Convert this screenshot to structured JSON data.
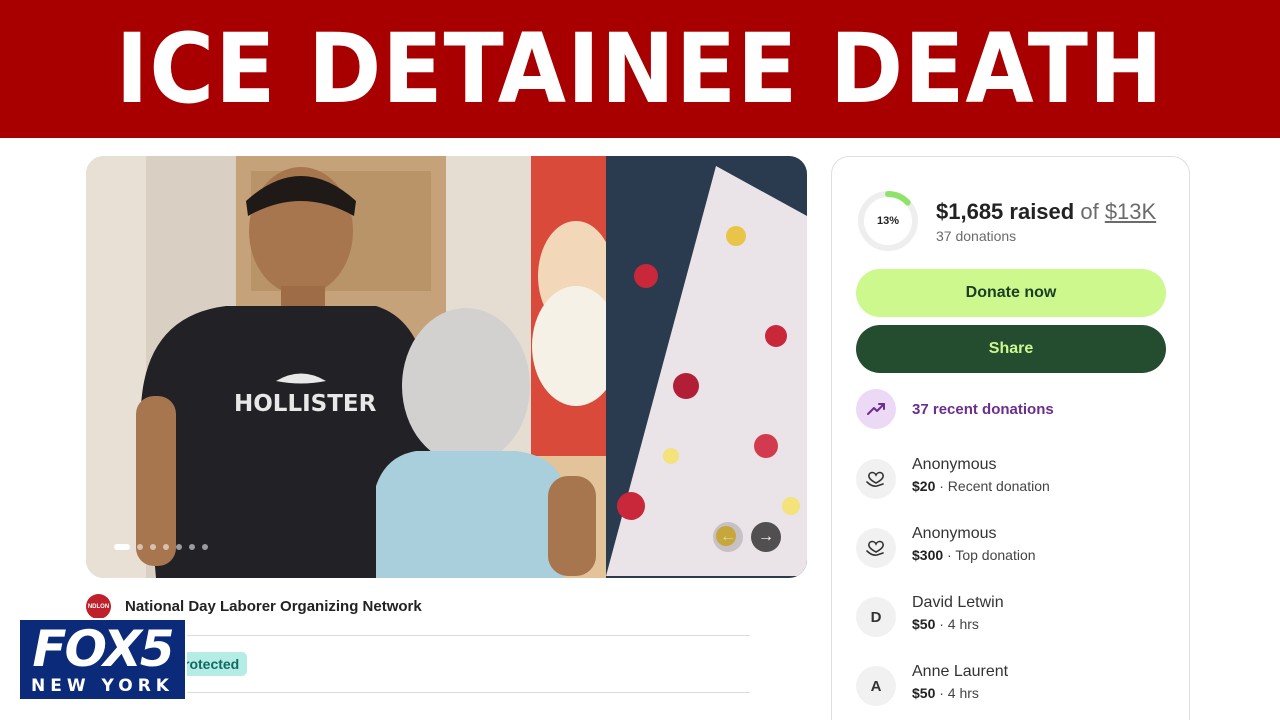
{
  "headline": "ICE DETAINEE DEATH",
  "carousel": {
    "slides_total": 7,
    "active_slide": 1,
    "prev_glyph": "←",
    "next_glyph": "→",
    "photo_shirt_text": "HOLLISTER"
  },
  "organizer": {
    "logo_text": "NDLON",
    "name": "National Day Laborer Organizing Network"
  },
  "badge": {
    "label": "rotected"
  },
  "station": {
    "brand": "FOX5",
    "city": "NEW YORK"
  },
  "fundraiser": {
    "progress_percent": 13,
    "progress_label": "13%",
    "raised": "$1,685 raised",
    "of_text": " of ",
    "goal": "$13K",
    "donations_count": "37 donations",
    "donate_label": "Donate now",
    "share_label": "Share",
    "recent_label": "37 recent donations",
    "donors": [
      {
        "avatar": "",
        "icon": "heart-hand-icon",
        "name": "Anonymous",
        "amount": "$20",
        "detail": " · Recent donation"
      },
      {
        "avatar": "",
        "icon": "heart-hand-icon",
        "name": "Anonymous",
        "amount": "$300",
        "detail": " · Top donation"
      },
      {
        "avatar": "D",
        "icon": "",
        "name": "David Letwin",
        "amount": "$50",
        "detail": " · 4 hrs"
      },
      {
        "avatar": "A",
        "icon": "",
        "name": "Anne Laurent",
        "amount": "$50",
        "detail": " · 4 hrs"
      }
    ]
  },
  "colors": {
    "banner": "#a80000",
    "donate_button": "#ccf88e",
    "share_button": "#244d30",
    "recent_accent": "#6c2e8c",
    "badge": "#b6ece6",
    "fox_blue": "#0b2a7a"
  }
}
